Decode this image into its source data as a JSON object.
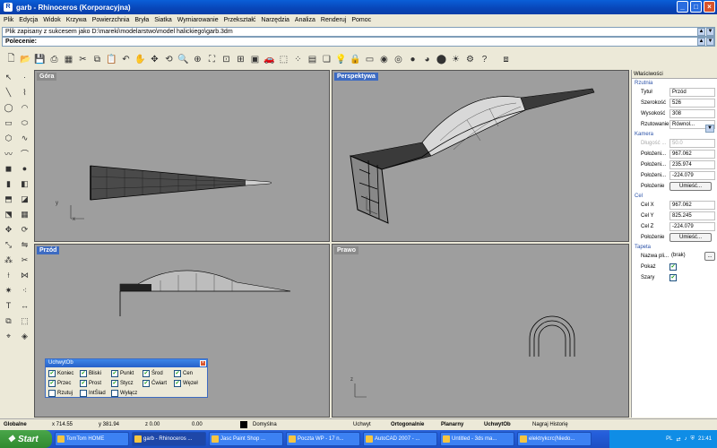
{
  "window": {
    "title": "garb - Rhinoceros (Korporacyjna)",
    "min": "_",
    "max": "□",
    "close": "×"
  },
  "menu": [
    "Plik",
    "Edycja",
    "Widok",
    "Krzywa",
    "Powierzchnia",
    "Bryła",
    "Siatka",
    "Wymiarowanie",
    "Przekształć",
    "Narzędzia",
    "Analiza",
    "Renderuj",
    "Pomoc"
  ],
  "command": {
    "history": "Plik zapisany z sukcesem jako D:\\mareki\\modelarstwo\\model halickiego\\garb.3dm",
    "prompt_label": "Polecenie:",
    "value": ""
  },
  "viewports": {
    "top": "Góra",
    "perspective": "Perspektywa",
    "front": "Przód",
    "right": "Prawo"
  },
  "axes": {
    "x": "x",
    "y": "y",
    "z": "z"
  },
  "properties": {
    "header": "Właściwości",
    "sections": {
      "viewport": "Rzutnia",
      "camera": "Kamera",
      "target": "Cel",
      "wallpaper": "Tapeta"
    },
    "viewport_rows": [
      {
        "label": "Tytuł",
        "value": "Przód"
      },
      {
        "label": "Szerokość",
        "value": "526"
      },
      {
        "label": "Wysokość",
        "value": "308"
      },
      {
        "label": "Rzutowanie",
        "value": "Równol..."
      }
    ],
    "camera_rows": [
      {
        "label": "Długość ...",
        "value": "50.0"
      },
      {
        "label": "Położeni...",
        "value": "967.062"
      },
      {
        "label": "Położeni...",
        "value": "235.974"
      },
      {
        "label": "Położeni...",
        "value": "-224.079"
      }
    ],
    "camera_place_label": "Położenie",
    "camera_place_button": "Umieść...",
    "target_rows": [
      {
        "label": "Cel X",
        "value": "967.062"
      },
      {
        "label": "Cel Y",
        "value": "825.245"
      },
      {
        "label": "Cel Z",
        "value": "-224.079"
      }
    ],
    "target_place_label": "Położenie",
    "target_place_button": "Umieść...",
    "wallpaper_name_label": "Nazwa pli...",
    "wallpaper_name_value": "(brak)",
    "wallpaper_name_button": "...",
    "show_label": "Pokaż",
    "gray_label": "Szary"
  },
  "osnap": {
    "title": "UchwytOb",
    "close": "×",
    "items": [
      {
        "label": "Koniec",
        "checked": true
      },
      {
        "label": "Bliski",
        "checked": true
      },
      {
        "label": "Punkt",
        "checked": true
      },
      {
        "label": "Środ",
        "checked": true
      },
      {
        "label": "Cen",
        "checked": true
      },
      {
        "label": "Przec",
        "checked": true
      },
      {
        "label": "Prost",
        "checked": true
      },
      {
        "label": "Stycz",
        "checked": true
      },
      {
        "label": "Ćwiart",
        "checked": true
      },
      {
        "label": "Węzeł",
        "checked": true
      },
      {
        "label": "Rzutuj",
        "checked": false
      },
      {
        "label": "IntŚlad",
        "checked": false
      },
      {
        "label": "Wyłącz",
        "checked": false
      }
    ]
  },
  "status": {
    "cplane": "Globalne",
    "x": "x 714.55",
    "y": "y 381.94",
    "z": "z 0.00",
    "dist": "0.00",
    "layer": "Domyślna",
    "grid_snap": "Uchwyt",
    "ortho": "Ortogonalnie",
    "planar": "Planarny",
    "osnap": "UchwytOb",
    "history": "Nagraj Historię"
  },
  "taskbar": {
    "start": "Start",
    "tasks": [
      "TomTom HOME",
      "garb - Rhinoceros ...",
      "Jasc Paint Shop ...",
      "Poczta WP - 17 n...",
      "AutoCAD 2007 - ...",
      "Untitled - 3ds ma...",
      "elektrykcrc(Niedo..."
    ],
    "lang": "PL",
    "clock": "21:41"
  },
  "colors": {
    "viewport_bg": "#9e9e9e",
    "active_label": "#3d6bc2",
    "xp_blue": "#245edb"
  }
}
